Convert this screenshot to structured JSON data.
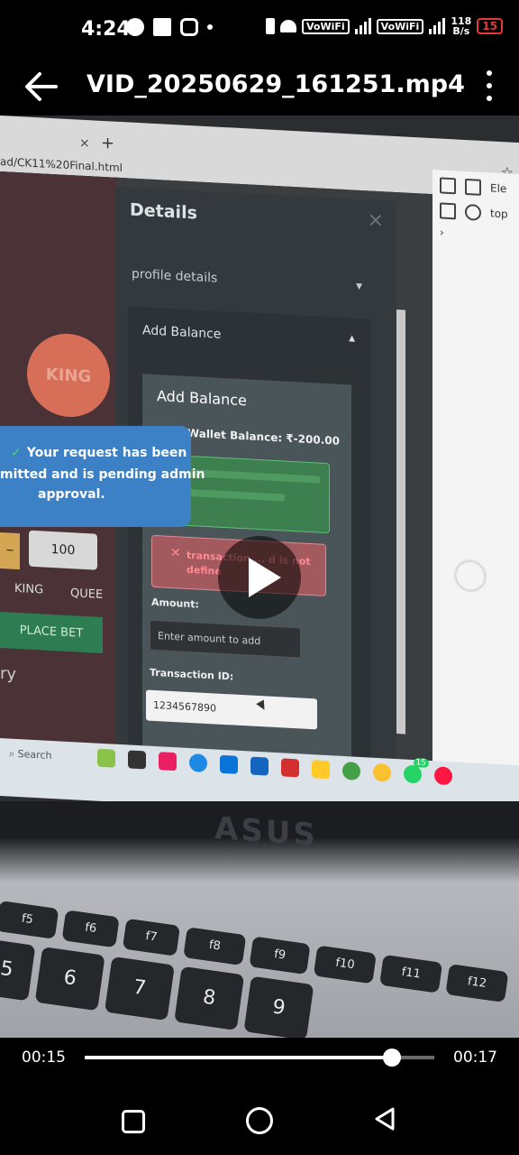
{
  "status_bar": {
    "time": "4:24",
    "network_labels": [
      "VoWiFi",
      "VoWiFi"
    ],
    "speed_value": "118",
    "speed_unit": "B/s",
    "battery": "15"
  },
  "app_bar": {
    "title": "VID_20250629_161251.mp4"
  },
  "video_frame": {
    "browser": {
      "tab_close": "×",
      "new_tab": "+",
      "url_fragment": "ad/CK11%20Final.html"
    },
    "game": {
      "coin_label": "KING",
      "minus_label": "–",
      "bet_amount": "100",
      "option_king": "KING",
      "option_queen": "QUEE",
      "place_bet": "PLACE BET",
      "history_fragment": "ry"
    },
    "toast": {
      "line1": "Your request has been",
      "line2": "mitted and is pending admin",
      "line3": "approval."
    },
    "modal": {
      "title": "Details",
      "close": "×",
      "profile_section": "profile details",
      "add_balance_section": "Add Balance",
      "add_balance_title": "Add Balance",
      "wallet_balance": "t Wallet Balance: ₹-200.00",
      "error_text": "transaction ... d is not define",
      "amount_label": "Amount:",
      "amount_placeholder": "Enter amount to add",
      "transaction_label": "Transaction ID:",
      "transaction_value": "1234567890"
    },
    "devtools": {
      "tab_label": "Ele",
      "context": "top"
    },
    "taskbar": {
      "search": "Search",
      "notification_count": "15"
    },
    "laptop": {
      "brand": "ASUS",
      "keys": [
        "f5",
        "f6",
        "f7",
        "f8",
        "f9",
        "f10",
        "f11",
        "f12",
        "5",
        "6",
        "7",
        "8",
        "9"
      ]
    }
  },
  "player": {
    "current_time": "00:15",
    "duration": "00:17",
    "progress": 0.88
  }
}
